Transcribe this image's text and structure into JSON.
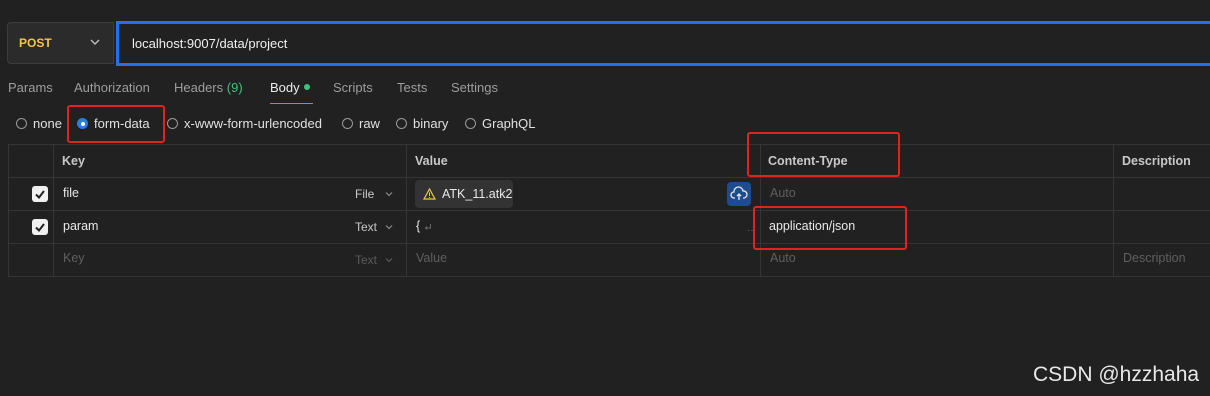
{
  "request": {
    "method": "POST",
    "url": "localhost:9007/data/project"
  },
  "tabs": [
    {
      "label": "Params"
    },
    {
      "label": "Authorization"
    },
    {
      "label": "Headers",
      "count": "(9)"
    },
    {
      "label": "Body"
    },
    {
      "label": "Scripts"
    },
    {
      "label": "Tests"
    },
    {
      "label": "Settings"
    }
  ],
  "body_types": [
    "none",
    "form-data",
    "x-www-form-urlencoded",
    "raw",
    "binary",
    "GraphQL"
  ],
  "selected_body_type": "form-data",
  "table": {
    "headers": {
      "key": "Key",
      "value": "Value",
      "content_type": "Content-Type",
      "description": "Description"
    },
    "rows": [
      {
        "checked": true,
        "key": "file",
        "type": "File",
        "value": "ATK_11.atk2",
        "content_type_placeholder": "Auto"
      },
      {
        "checked": true,
        "key": "param",
        "type": "Text",
        "value": "{",
        "content_type": "application/json"
      }
    ],
    "empty_row": {
      "key": "Key",
      "type": "Text",
      "value": "Value",
      "content_type": "Auto",
      "description": "Description"
    }
  },
  "colors": {
    "accent": "#1e74e6",
    "method": "#f5c542",
    "highlight": "#e0231c",
    "active_dot": "#3cc47c"
  },
  "watermark": "CSDN @hzzhaha"
}
